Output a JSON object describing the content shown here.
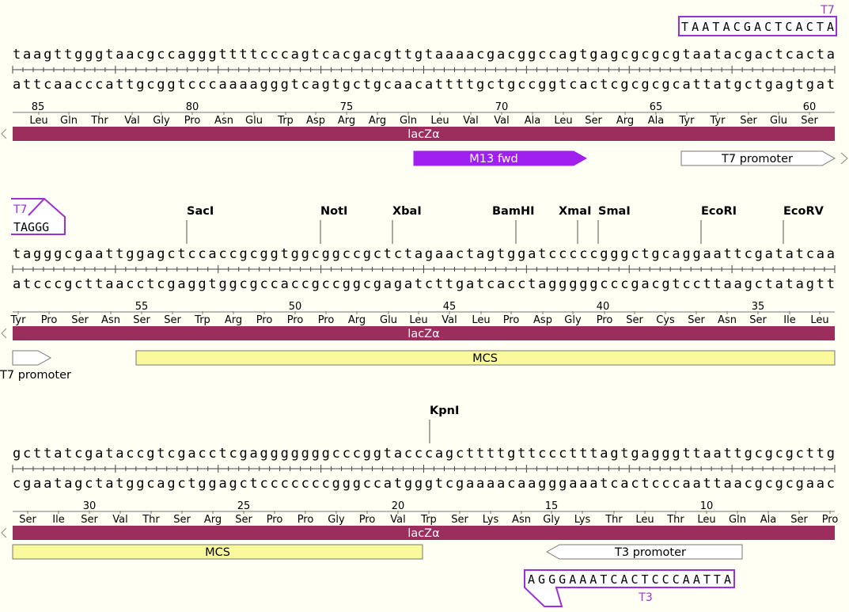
{
  "colors": {
    "background": "#fffff4",
    "lacz": "#9c2e5e",
    "m13": "#a020f0",
    "mcs": "#fafa9c",
    "promoter": "#ffffff",
    "primer": "#9b30d9"
  },
  "rows": [
    {
      "top": "taagttgggtaacgccagggttttcccagtcacgacgttgtaaaacgacggccagtgagcgcgcgtaatacgactcacta",
      "bottom": "attcaacccattgcggtcccaaaagggtcagtgctgcaacattttgctgccggtcactcgcgcgcattatgctgagtgat",
      "aa": [
        "Leu",
        "Gln",
        "Thr",
        "Val",
        "Gly",
        "Pro",
        "Asn",
        "Glu",
        "Trp",
        "Asp",
        "Arg",
        "Arg",
        "Gln",
        "Leu",
        "Val",
        "Val",
        "Ala",
        "Leu",
        "Ser",
        "Arg",
        "Ala",
        "Tyr",
        "Tyr",
        "Ser",
        "Glu",
        "Ser"
      ],
      "numbers": [
        "85",
        "80",
        "75",
        "70",
        "65",
        "60"
      ],
      "lacz_label": "lacZα",
      "features": [
        {
          "name": "M13 fwd"
        },
        {
          "name": "T7 promoter"
        }
      ],
      "primer": {
        "seq": "TAATACGACTCACTA",
        "name": "T7"
      }
    },
    {
      "top": "tagggcgaattggagctccaccgcggtggcggccgctctagaactagtggatcccccgggctgcaggaattcgatatcaa",
      "bottom": "atcccgcttaacctcgaggtggcgccaccgccggcgagatcttgatcacctagggggcccgacgtccttaagctatagtt",
      "aa": [
        "Tyr",
        "Pro",
        "Ser",
        "Asn",
        "Ser",
        "Ser",
        "Trp",
        "Arg",
        "Pro",
        "Pro",
        "Pro",
        "Arg",
        "Glu",
        "Leu",
        "Val",
        "Leu",
        "Pro",
        "Asp",
        "Gly",
        "Pro",
        "Ser",
        "Cys",
        "Ser",
        "Asn",
        "Ser",
        "Ile",
        "Leu"
      ],
      "numbers": [
        "55",
        "50",
        "45",
        "40",
        "35"
      ],
      "lacz_label": "lacZα",
      "enzymes": [
        "SacI",
        "NotI",
        "XbaI",
        "BamHI",
        "XmaI",
        "SmaI",
        "EcoRI",
        "EcoRV"
      ],
      "features": [
        {
          "name": "T7 promoter"
        },
        {
          "name": "MCS"
        }
      ],
      "primer": {
        "seq": "TAGGG",
        "name": "T7"
      }
    },
    {
      "top": "gcttatcgataccgtcgacctcgagggggggcccggtacccagcttttgttccctttagtgagggttaattgcgcgcttg",
      "bottom": "cgaatagctatggcagctggagctcccccccgggccatgggtcgaaaacaagggaaatcactcccaattaacgcgcgaac",
      "aa": [
        "Ser",
        "Ile",
        "Ser",
        "Val",
        "Thr",
        "Ser",
        "Arg",
        "Ser",
        "Pro",
        "Pro",
        "Gly",
        "Pro",
        "Val",
        "Trp",
        "Ser",
        "Lys",
        "Asn",
        "Gly",
        "Lys",
        "Thr",
        "Leu",
        "Thr",
        "Leu",
        "Gln",
        "Ala",
        "Ser",
        "Pro"
      ],
      "numbers": [
        "30",
        "25",
        "20",
        "15",
        "10"
      ],
      "lacz_label": "lacZα",
      "enzymes": [
        "KpnI"
      ],
      "features": [
        {
          "name": "MCS"
        },
        {
          "name": "T3 promoter"
        }
      ],
      "primer": {
        "seq": "AGGGAAATCACTCCCAATTA",
        "name": "T3"
      }
    }
  ]
}
